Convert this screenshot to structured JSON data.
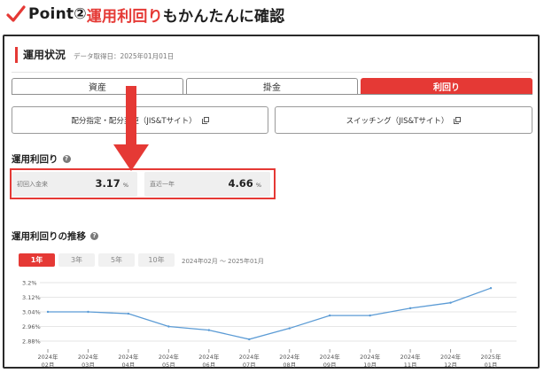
{
  "heading": {
    "prefix": "Point② ",
    "accent": "運用利回り",
    "suffix": "もかんたんに確認",
    "accent_color": "#e53935",
    "icon": "red-checkmark-icon"
  },
  "panel": {
    "title": "運用状況",
    "data_date": "データ取得日：2025年01月01日"
  },
  "tabs": [
    {
      "label": "資産",
      "active": false
    },
    {
      "label": "掛金",
      "active": false
    },
    {
      "label": "利回り",
      "active": true
    }
  ],
  "links": [
    {
      "label": "配分指定・配分変更（JIS&Tサイト）",
      "icon": "external-window-icon"
    },
    {
      "label": "スイッチング（JIS&Tサイト）",
      "icon": "external-window-icon"
    }
  ],
  "yield": {
    "title": "運用利回り",
    "help_icon": "question-icon",
    "boxes": [
      {
        "label": "初回入金来",
        "value": "3.17",
        "unit": "%"
      },
      {
        "label": "直近一年",
        "value": "4.66",
        "unit": "%"
      }
    ]
  },
  "trend": {
    "title": "運用利回りの推移",
    "help_icon": "question-icon",
    "range_tabs": [
      {
        "label": "1年",
        "active": true
      },
      {
        "label": "3年",
        "active": false
      },
      {
        "label": "5年",
        "active": false
      },
      {
        "label": "10年",
        "active": false
      }
    ],
    "period_text": "2024年02月 〜 2025年01月"
  },
  "chart_data": {
    "type": "line",
    "x": [
      "2024年02月",
      "2024年03月",
      "2024年04月",
      "2024年05月",
      "2024年06月",
      "2024年07月",
      "2024年08月",
      "2024年09月",
      "2024年10月",
      "2024年11月",
      "2024年12月",
      "2025年01月"
    ],
    "x_ticks": [
      {
        "top": "2024年",
        "bottom": "02月"
      },
      {
        "top": "2024年",
        "bottom": "03月"
      },
      {
        "top": "2024年",
        "bottom": "04月"
      },
      {
        "top": "2024年",
        "bottom": "05月"
      },
      {
        "top": "2024年",
        "bottom": "06月"
      },
      {
        "top": "2024年",
        "bottom": "07月"
      },
      {
        "top": "2024年",
        "bottom": "08月"
      },
      {
        "top": "2024年",
        "bottom": "09月"
      },
      {
        "top": "2024年",
        "bottom": "10月"
      },
      {
        "top": "2024年",
        "bottom": "11月"
      },
      {
        "top": "2024年",
        "bottom": "12月"
      },
      {
        "top": "2025年",
        "bottom": "01月"
      }
    ],
    "series": [
      {
        "values": [
          3.04,
          3.04,
          3.03,
          2.96,
          2.94,
          2.89,
          2.95,
          3.02,
          3.02,
          3.06,
          3.09,
          3.17
        ],
        "color": "#5b9bd5"
      }
    ],
    "yticks": [
      2.88,
      2.96,
      3.04,
      3.12,
      3.2
    ],
    "ytick_labels": [
      "2.88%",
      "2.96%",
      "3.04%",
      "3.12%",
      "3.2%"
    ],
    "ylim": [
      2.88,
      3.2
    ],
    "grid": true,
    "xlabel": "",
    "ylabel": ""
  }
}
